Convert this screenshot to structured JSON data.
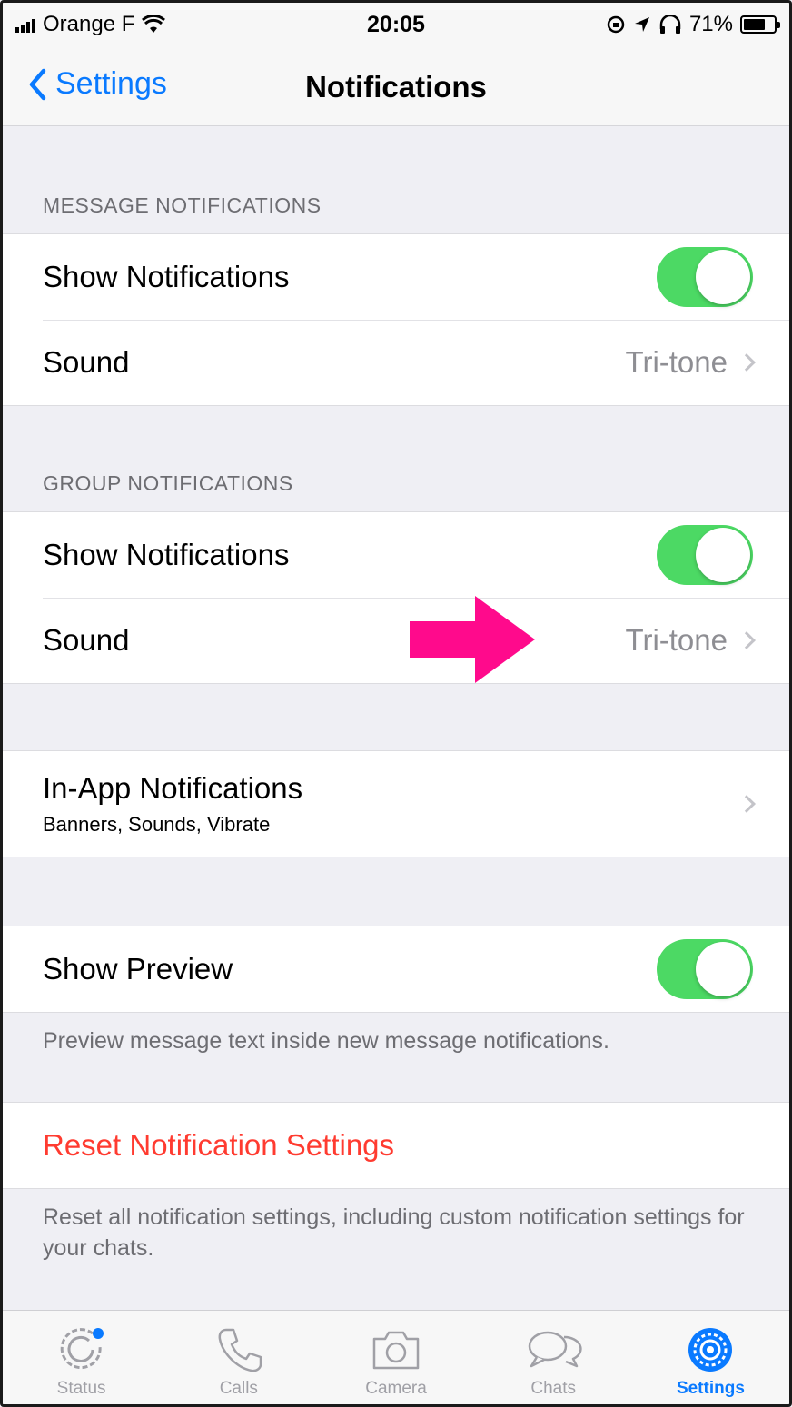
{
  "status_bar": {
    "carrier": "Orange F",
    "time": "20:05",
    "battery": "71%",
    "battery_level": 0.71
  },
  "nav": {
    "back_label": "Settings",
    "title": "Notifications"
  },
  "message_notifications": {
    "header": "MESSAGE NOTIFICATIONS",
    "show_label": "Show Notifications",
    "show_on": true,
    "sound_label": "Sound",
    "sound_value": "Tri-tone"
  },
  "group_notifications": {
    "header": "GROUP NOTIFICATIONS",
    "show_label": "Show Notifications",
    "show_on": true,
    "sound_label": "Sound",
    "sound_value": "Tri-tone"
  },
  "in_app": {
    "label": "In-App Notifications",
    "sub": "Banners, Sounds, Vibrate"
  },
  "preview": {
    "label": "Show Preview",
    "on": true,
    "note": "Preview message text inside new message notifications."
  },
  "reset": {
    "label": "Reset Notification Settings",
    "note": "Reset all notification settings, including custom notification settings for your chats."
  },
  "tabs": [
    {
      "label": "Status",
      "icon": "status-icon",
      "active": false
    },
    {
      "label": "Calls",
      "icon": "phone-icon",
      "active": false
    },
    {
      "label": "Camera",
      "icon": "camera-icon",
      "active": false
    },
    {
      "label": "Chats",
      "icon": "chat-bubbles-icon",
      "active": false
    },
    {
      "label": "Settings",
      "icon": "gear-icon",
      "active": true
    }
  ],
  "colors": {
    "accent": "#0a7aff",
    "toggle_on": "#4cd964",
    "destructive": "#ff3b30",
    "annotation_arrow": "#ff0a8c"
  }
}
